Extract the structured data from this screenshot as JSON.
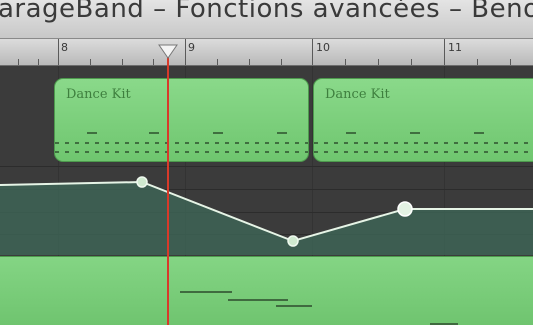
{
  "window": {
    "title": "arageBand – Fonctions avancées – Benoit"
  },
  "ruler": {
    "bars": [
      "8",
      "9",
      "10",
      "11"
    ]
  },
  "regions": {
    "top": [
      {
        "label": "Dance Kit"
      },
      {
        "label": "Dance Kit"
      }
    ]
  },
  "colors": {
    "region_green": "#7ed07e",
    "track_bg": "#3b3b3b",
    "playhead": "#d83a2a",
    "automation_fill": "#3f6a5a",
    "automation_line": "#e6f4e6"
  },
  "icons": {
    "playhead": "playhead-triangle-icon"
  }
}
